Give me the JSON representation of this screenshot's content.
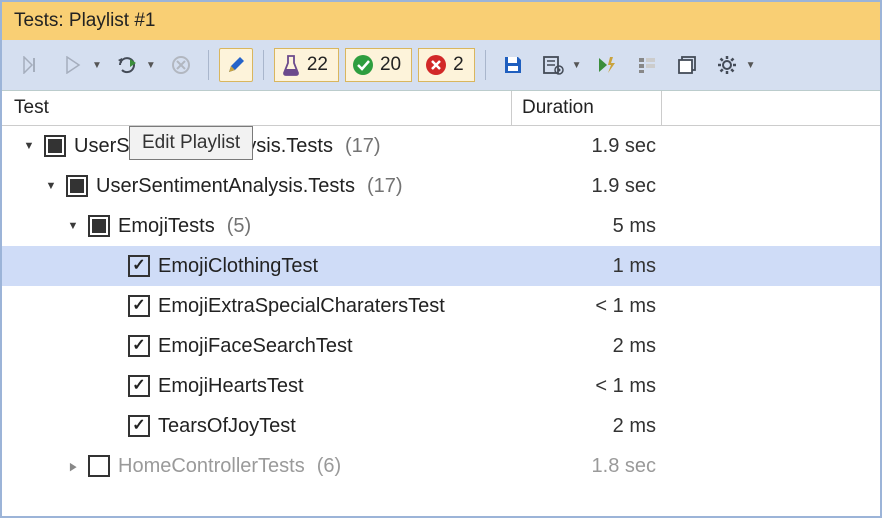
{
  "title": "Tests: Playlist #1",
  "tooltip": "Edit Playlist",
  "columns": {
    "test": "Test",
    "duration": "Duration"
  },
  "chips": {
    "beaker": "22",
    "pass": "20",
    "fail": "2"
  },
  "rows": [
    {
      "indent": 20,
      "arrow": "open",
      "cb": "tri",
      "name": "UserSentimentAnalysis.Tests",
      "count": "(17)",
      "dur": "1.9 sec"
    },
    {
      "indent": 42,
      "arrow": "open",
      "cb": "tri",
      "name": "UserSentimentAnalysis.Tests",
      "count": "(17)",
      "dur": "1.9 sec"
    },
    {
      "indent": 64,
      "arrow": "open",
      "cb": "tri",
      "name": "EmojiTests",
      "count": "(5)",
      "dur": "5 ms"
    },
    {
      "indent": 104,
      "arrow": "none",
      "cb": "check",
      "name": "EmojiClothingTest",
      "count": "",
      "dur": "1 ms",
      "sel": true
    },
    {
      "indent": 104,
      "arrow": "none",
      "cb": "check",
      "name": "EmojiExtraSpecialCharatersTest",
      "count": "",
      "dur": "< 1 ms"
    },
    {
      "indent": 104,
      "arrow": "none",
      "cb": "check",
      "name": "EmojiFaceSearchTest",
      "count": "",
      "dur": "2 ms"
    },
    {
      "indent": 104,
      "arrow": "none",
      "cb": "check",
      "name": "EmojiHeartsTest",
      "count": "",
      "dur": "< 1 ms"
    },
    {
      "indent": 104,
      "arrow": "none",
      "cb": "check",
      "name": "TearsOfJoyTest",
      "count": "",
      "dur": "2 ms"
    },
    {
      "indent": 64,
      "arrow": "closed",
      "cb": "empty",
      "name": "HomeControllerTests",
      "count": "(6)",
      "dur": "1.8 sec",
      "dim": true
    }
  ]
}
